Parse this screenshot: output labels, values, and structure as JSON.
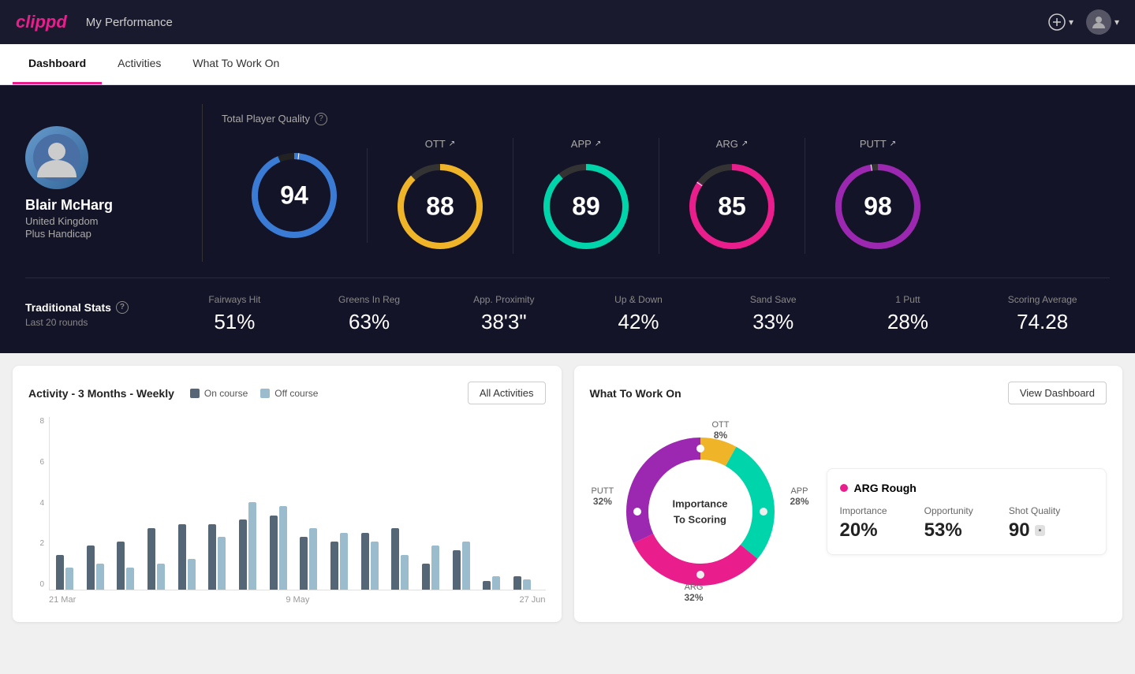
{
  "header": {
    "logo": "clippd",
    "title": "My Performance",
    "add_icon": "⊕",
    "user_icon": "👤"
  },
  "tabs": [
    {
      "id": "dashboard",
      "label": "Dashboard",
      "active": true
    },
    {
      "id": "activities",
      "label": "Activities",
      "active": false
    },
    {
      "id": "what-to-work-on",
      "label": "What To Work On",
      "active": false
    }
  ],
  "player": {
    "name": "Blair McHarg",
    "country": "United Kingdom",
    "handicap": "Plus Handicap"
  },
  "total_quality": {
    "label": "Total Player Quality",
    "value": 94,
    "color": "#3a7bd5"
  },
  "metrics": [
    {
      "id": "ott",
      "label": "OTT",
      "value": 88,
      "color": "#f0b429",
      "track_color": "#333"
    },
    {
      "id": "app",
      "label": "APP",
      "value": 89,
      "color": "#00d4aa",
      "track_color": "#333"
    },
    {
      "id": "arg",
      "label": "ARG",
      "value": 85,
      "color": "#e91e8c",
      "track_color": "#333"
    },
    {
      "id": "putt",
      "label": "PUTT",
      "value": 98,
      "color": "#9c27b0",
      "track_color": "#333"
    }
  ],
  "traditional_stats": {
    "label": "Traditional Stats",
    "period": "Last 20 rounds",
    "items": [
      {
        "label": "Fairways Hit",
        "value": "51%"
      },
      {
        "label": "Greens In Reg",
        "value": "63%"
      },
      {
        "label": "App. Proximity",
        "value": "38'3\""
      },
      {
        "label": "Up & Down",
        "value": "42%"
      },
      {
        "label": "Sand Save",
        "value": "33%"
      },
      {
        "label": "1 Putt",
        "value": "28%"
      },
      {
        "label": "Scoring Average",
        "value": "74.28"
      }
    ]
  },
  "activity_chart": {
    "title": "Activity - 3 Months - Weekly",
    "legend": [
      {
        "label": "On course",
        "color": "#556677"
      },
      {
        "label": "Off course",
        "color": "#9bbccc"
      }
    ],
    "button": "All Activities",
    "y_labels": [
      "0",
      "2",
      "4",
      "6",
      "8"
    ],
    "x_labels": [
      "21 Mar",
      "9 May",
      "27 Jun"
    ],
    "bars": [
      {
        "on": 40,
        "off": 25
      },
      {
        "on": 50,
        "off": 30
      },
      {
        "on": 55,
        "off": 25
      },
      {
        "on": 70,
        "off": 30
      },
      {
        "on": 75,
        "off": 35
      },
      {
        "on": 75,
        "off": 60
      },
      {
        "on": 80,
        "off": 100
      },
      {
        "on": 85,
        "off": 95
      },
      {
        "on": 60,
        "off": 70
      },
      {
        "on": 55,
        "off": 65
      },
      {
        "on": 65,
        "off": 55
      },
      {
        "on": 70,
        "off": 40
      },
      {
        "on": 30,
        "off": 50
      },
      {
        "on": 45,
        "off": 55
      },
      {
        "on": 10,
        "off": 15
      },
      {
        "on": 15,
        "off": 12
      }
    ]
  },
  "what_to_work_on": {
    "title": "What To Work On",
    "button": "View Dashboard",
    "center_label_line1": "Importance",
    "center_label_line2": "To Scoring",
    "segments": [
      {
        "id": "ott",
        "label": "OTT",
        "value": "8%",
        "color": "#f0b429",
        "position": "top"
      },
      {
        "id": "app",
        "label": "APP",
        "value": "28%",
        "color": "#00d4aa",
        "position": "right"
      },
      {
        "id": "arg",
        "label": "ARG",
        "value": "32%",
        "color": "#e91e8c",
        "position": "bottom"
      },
      {
        "id": "putt",
        "label": "PUTT",
        "value": "32%",
        "color": "#9c27b0",
        "position": "left"
      }
    ],
    "info_card": {
      "title": "ARG Rough",
      "metrics": [
        {
          "label": "Importance",
          "value": "20%"
        },
        {
          "label": "Opportunity",
          "value": "53%"
        },
        {
          "label": "Shot Quality",
          "value": "90"
        }
      ]
    }
  }
}
